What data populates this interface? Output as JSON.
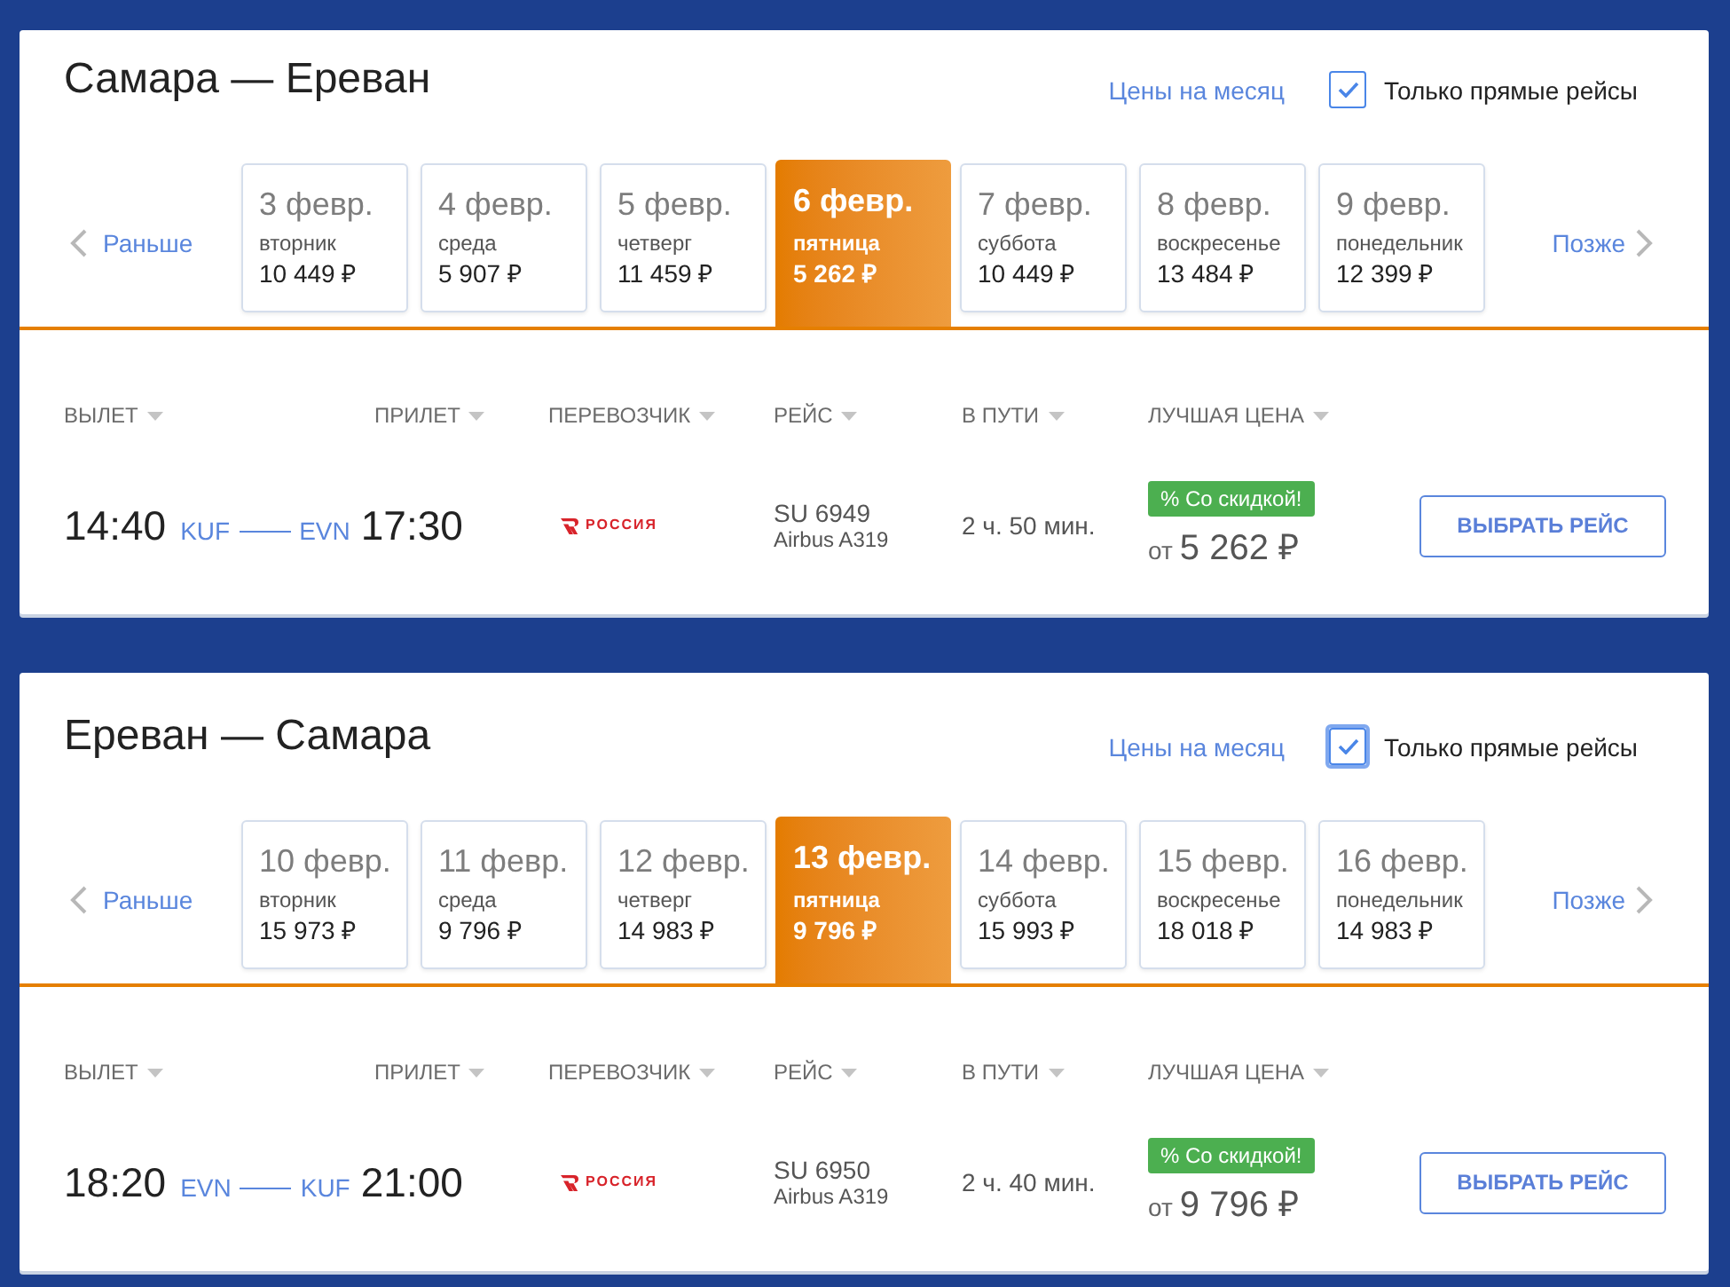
{
  "routes": [
    {
      "title": "Самара — Ереван",
      "month_prices_link": "Цены на месяц",
      "direct_only": {
        "label": "Только прямые рейсы",
        "checked": true,
        "focused": false
      },
      "earlier": "Раньше",
      "later": "Позже",
      "dates": [
        {
          "date": "3 февр.",
          "weekday": "вторник",
          "price": "10 449 ₽",
          "selected": false
        },
        {
          "date": "4 февр.",
          "weekday": "среда",
          "price": "5 907 ₽",
          "selected": false
        },
        {
          "date": "5 февр.",
          "weekday": "четверг",
          "price": "11 459 ₽",
          "selected": false
        },
        {
          "date": "6 февр.",
          "weekday": "пятница",
          "price": "5 262 ₽",
          "selected": true
        },
        {
          "date": "7 февр.",
          "weekday": "суббота",
          "price": "10 449 ₽",
          "selected": false
        },
        {
          "date": "8 февр.",
          "weekday": "воскресенье",
          "price": "13 484 ₽",
          "selected": false
        },
        {
          "date": "9 февр.",
          "weekday": "понедельник",
          "price": "12 399 ₽",
          "selected": false
        }
      ],
      "columns": [
        "ВЫЛЕТ",
        "ПРИЛЕТ",
        "ПЕРЕВОЗЧИК",
        "РЕЙС",
        "В ПУТИ",
        "ЛУЧШАЯ ЦЕНА"
      ],
      "flight": {
        "departure_time": "14:40",
        "from": "KUF",
        "to": "EVN",
        "arrival_time": "17:30",
        "airline": "РОССИЯ",
        "flight_number": "SU 6949",
        "aircraft": "Airbus A319",
        "duration": "2 ч. 50 мин.",
        "badge": "% Со скидкой!",
        "price_prefix": "от",
        "price": "5 262 ₽",
        "button": "ВЫБРАТЬ РЕЙС"
      }
    },
    {
      "title": "Ереван — Самара",
      "month_prices_link": "Цены на месяц",
      "direct_only": {
        "label": "Только прямые рейсы",
        "checked": true,
        "focused": true
      },
      "earlier": "Раньше",
      "later": "Позже",
      "dates": [
        {
          "date": "10 февр.",
          "weekday": "вторник",
          "price": "15 973 ₽",
          "selected": false
        },
        {
          "date": "11 февр.",
          "weekday": "среда",
          "price": "9 796 ₽",
          "selected": false
        },
        {
          "date": "12 февр.",
          "weekday": "четверг",
          "price": "14 983 ₽",
          "selected": false
        },
        {
          "date": "13 февр.",
          "weekday": "пятница",
          "price": "9 796 ₽",
          "selected": true
        },
        {
          "date": "14 февр.",
          "weekday": "суббота",
          "price": "15 993 ₽",
          "selected": false
        },
        {
          "date": "15 февр.",
          "weekday": "воскресенье",
          "price": "18 018 ₽",
          "selected": false
        },
        {
          "date": "16 февр.",
          "weekday": "понедельник",
          "price": "14 983 ₽",
          "selected": false
        }
      ],
      "columns": [
        "ВЫЛЕТ",
        "ПРИЛЕТ",
        "ПЕРЕВОЗЧИК",
        "РЕЙС",
        "В ПУТИ",
        "ЛУЧШАЯ ЦЕНА"
      ],
      "flight": {
        "departure_time": "18:20",
        "from": "EVN",
        "to": "KUF",
        "arrival_time": "21:00",
        "airline": "РОССИЯ",
        "flight_number": "SU 6950",
        "aircraft": "Airbus A319",
        "duration": "2 ч. 40 мин.",
        "badge": "% Со скидкой!",
        "price_prefix": "от",
        "price": "9 796 ₽",
        "button": "ВЫБРАТЬ РЕЙС"
      }
    }
  ]
}
